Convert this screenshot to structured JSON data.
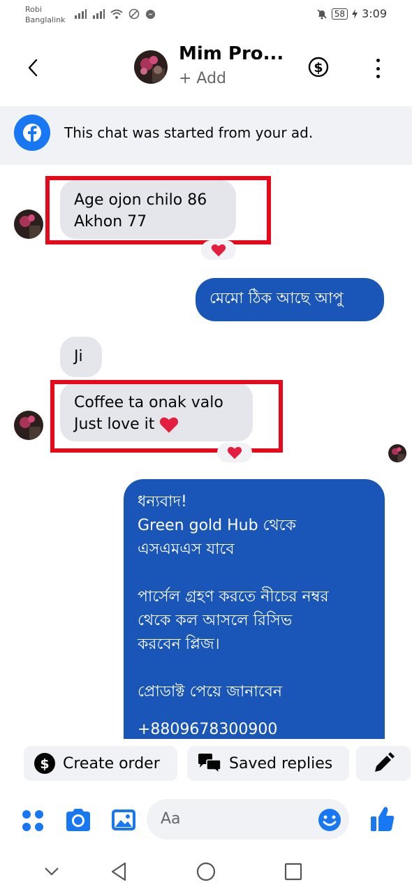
{
  "status_bar": {
    "carrier_line1": "Robi",
    "carrier_line2": "Banglalink",
    "battery": "58",
    "time": "3:09"
  },
  "header": {
    "contact_name": "Mim Pro...",
    "subtitle": "+ Add",
    "icons": [
      "back-arrow-icon",
      "dollar-icon",
      "more-vertical-icon"
    ]
  },
  "ad_banner": {
    "text": "This chat was started from your ad."
  },
  "messages": [
    {
      "direction": "in",
      "lines": [
        "Age ojon chilo 86",
        "Akhon 77"
      ],
      "reaction": "heart",
      "highlighted": true
    },
    {
      "direction": "out",
      "lines": [
        "মেমো ঠিক আছে আপু"
      ]
    },
    {
      "direction": "in",
      "lines": [
        "Ji"
      ]
    },
    {
      "direction": "in",
      "lines": [
        "Coffee ta onak valo",
        "Just love it"
      ],
      "emoji": "heart",
      "reaction": "heart",
      "highlighted": true
    },
    {
      "direction": "out",
      "lines": [
        "ধন্যবাদ!",
        "Green gold Hub থেকে",
        "এসএমএস যাবে",
        "",
        "পার্সেল গ্রহণ করতে নীচের নম্বর",
        "থেকে কল আসলে রিসিভ",
        "করবেন প্লিজ।",
        "",
        "প্রোডাক্ট পেয়ে জানাবেন",
        "",
        "+8809678300900"
      ]
    }
  ],
  "quick_actions": {
    "create_order": "Create order",
    "saved_replies": "Saved replies"
  },
  "composer": {
    "placeholder": "Aa"
  },
  "colors": {
    "accent": "#1877f2",
    "outgoing_bubble": "#1a55b8",
    "incoming_bubble": "#e4e6eb",
    "highlight_box": "#e8081a"
  }
}
